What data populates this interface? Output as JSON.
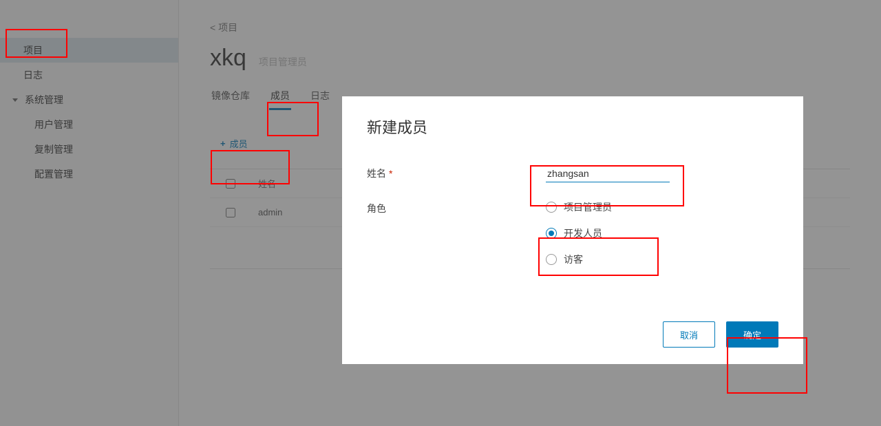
{
  "sidebar": {
    "items": [
      {
        "label": "项目",
        "selected": true
      },
      {
        "label": "日志"
      },
      {
        "label": "系统管理",
        "expandable": true,
        "children": [
          {
            "label": "用户管理"
          },
          {
            "label": "复制管理"
          },
          {
            "label": "配置管理"
          }
        ]
      }
    ]
  },
  "breadcrumb": "< 项目",
  "project": {
    "title": "xkq",
    "role_badge": "项目管理员"
  },
  "tabs": [
    {
      "label": "镜像仓库"
    },
    {
      "label": "成员",
      "active": true
    },
    {
      "label": "日志"
    }
  ],
  "add_member_btn": "成员",
  "table": {
    "header_name": "姓名",
    "rows": [
      {
        "name": "admin"
      }
    ]
  },
  "modal": {
    "title": "新建成员",
    "name_label": "姓名",
    "role_label": "角色",
    "name_value": "zhangsan",
    "roles": [
      {
        "label": "项目管理员"
      },
      {
        "label": "开发人员",
        "selected": true
      },
      {
        "label": "访客"
      }
    ],
    "cancel": "取消",
    "ok": "确定"
  }
}
